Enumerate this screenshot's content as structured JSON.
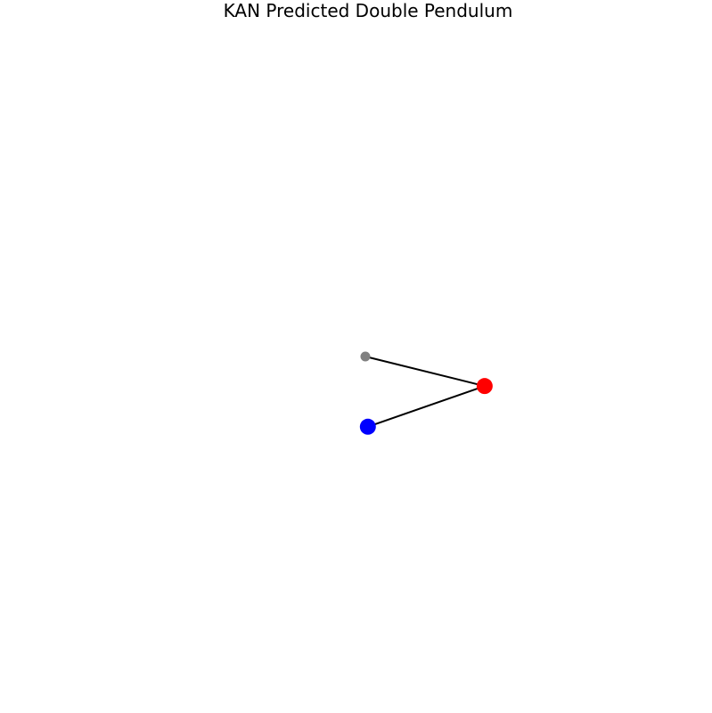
{
  "chart_data": {
    "type": "scatter",
    "title": "KAN Predicted Double Pendulum",
    "xlabel": "",
    "ylabel": "",
    "axes_visible": false,
    "grid": false,
    "xlim": [
      -2.2,
      2.2
    ],
    "ylim": [
      -2.2,
      2.2
    ],
    "series": [
      {
        "role": "pivot",
        "color": "#808080",
        "points": [
          {
            "x": 0.0,
            "y": 0.0
          }
        ]
      },
      {
        "role": "bob-1",
        "color": "#ff0000",
        "points": [
          {
            "x": 0.95,
            "y": -0.24
          }
        ]
      },
      {
        "role": "bob-2",
        "color": "#0000ff",
        "points": [
          {
            "x": 0.02,
            "y": -0.57
          }
        ]
      }
    ],
    "rod_color": "#000000"
  }
}
